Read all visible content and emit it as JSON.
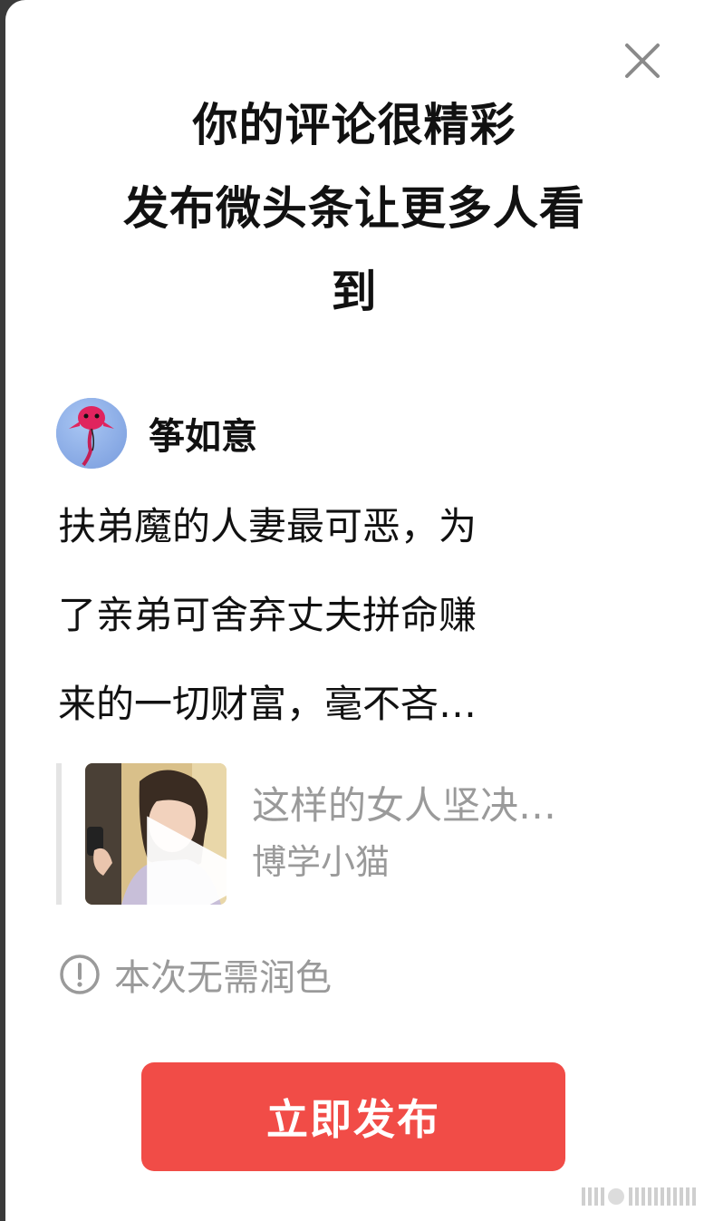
{
  "header": {
    "title_lines": [
      "你的评论很精彩",
      "发布微头条让更多人看",
      "到"
    ]
  },
  "author": {
    "name": "筝如意",
    "avatar_icon": "kite-avatar-icon"
  },
  "comment": {
    "lines": [
      "扶弟魔的人妻最可恶，为",
      "了亲弟可舍弃丈夫拼命赚",
      "来的一切财富，毫不吝…"
    ]
  },
  "quoted_post": {
    "title": "这样的女人坚决…",
    "author": "博学小猫",
    "thumbnail_icon": "video-thumbnail",
    "play_icon": "play-icon"
  },
  "notice": {
    "icon": "info-circle-icon",
    "text": "本次无需润色"
  },
  "actions": {
    "publish_label": "立即发布",
    "close_icon": "close-icon"
  },
  "colors": {
    "accent": "#f14c47",
    "text_primary": "#111111",
    "text_secondary": "#9a9a9a",
    "avatar_bg": "#8fb2ea"
  }
}
